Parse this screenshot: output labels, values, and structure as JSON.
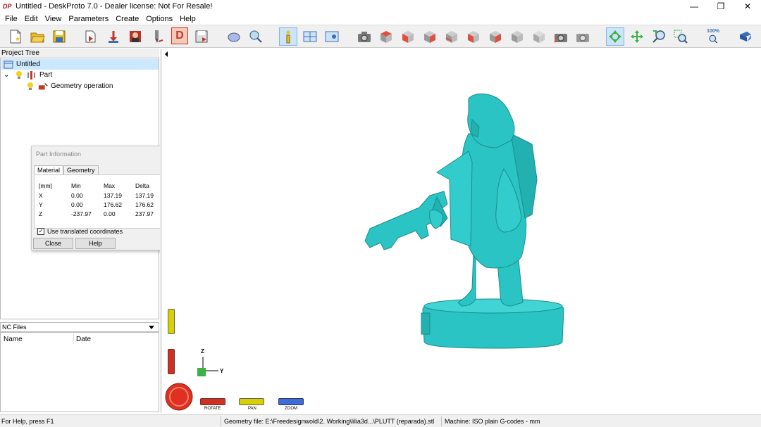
{
  "window": {
    "title": "Untitled - DeskProto 7.0 - Dealer license: Not For Resale!",
    "logo_text": "DP",
    "minimize": "—",
    "restore": "❐",
    "close": "✕"
  },
  "menu": [
    "File",
    "Edit",
    "View",
    "Parameters",
    "Create",
    "Options",
    "Help"
  ],
  "toolbar": {
    "zoom_label": "100%",
    "icons": [
      "new-file-icon",
      "open-folder-icon",
      "save-icon",
      "load-geometry-icon",
      "move-part-icon",
      "part-image-icon",
      "tool-icon",
      "tool-path-icon",
      "d-parameters-icon",
      "save-as-icon",
      "part-shape-icon",
      "magnify-part-icon",
      "info-icon",
      "layout-icon",
      "view-window-icon",
      "camera-icon",
      "cube-red-top-icon",
      "cube-red-front-icon",
      "cube-red-right-icon",
      "cube-gray-1-icon",
      "cube-gray-2-icon",
      "cube-gray-3-icon",
      "cube-gray-4-icon",
      "cube-gray-5-icon",
      "camera-red-icon",
      "camera-gray-icon",
      "rotate-icon",
      "pan-icon",
      "zoom-icon",
      "zoom-window-icon",
      "zoom-100-icon",
      "help-book-icon"
    ]
  },
  "project_tree": {
    "header": "Project Tree",
    "items": [
      {
        "label": "Untitled",
        "icon": "project-icon",
        "selected": true
      },
      {
        "label": "Part",
        "icon": "part-icon",
        "expand": "⌄"
      },
      {
        "label": "Geometry operation",
        "icon": "geometry-operation-icon"
      }
    ]
  },
  "part_info": {
    "title": "Part Information",
    "tabs": [
      "Material",
      "Geometry"
    ],
    "active_tab": "Material",
    "columns": [
      "[mm]",
      "Min",
      "Max",
      "Delta"
    ],
    "rows": [
      {
        "axis": "X",
        "min": "0.00",
        "max": "137.19",
        "delta": "137.19"
      },
      {
        "axis": "Y",
        "min": "0.00",
        "max": "176.62",
        "delta": "176.62"
      },
      {
        "axis": "Z",
        "min": "-237.97",
        "max": "0.00",
        "delta": "237.97"
      }
    ],
    "checkbox_label": "Use translated coordinates",
    "checkbox_checked": true,
    "close_label": "Close",
    "help_label": "Help"
  },
  "nc_files": {
    "header": "NC Files",
    "columns": [
      "Name",
      "Date"
    ]
  },
  "viewport": {
    "model_color": "#2bc4c4",
    "axis_z": "Z",
    "axis_y": "Y",
    "rotate_label": "ROTATE",
    "pan_label": "PAN",
    "zoom_label": "ZOOM"
  },
  "status": {
    "help": "For Help, press F1",
    "geometry_file": "Geometry file: E:\\Freedesignwold\\2. Working\\lilia3d...\\PLUTT (reparada).stl",
    "machine": "Machine: ISO plain G-codes - mm"
  }
}
